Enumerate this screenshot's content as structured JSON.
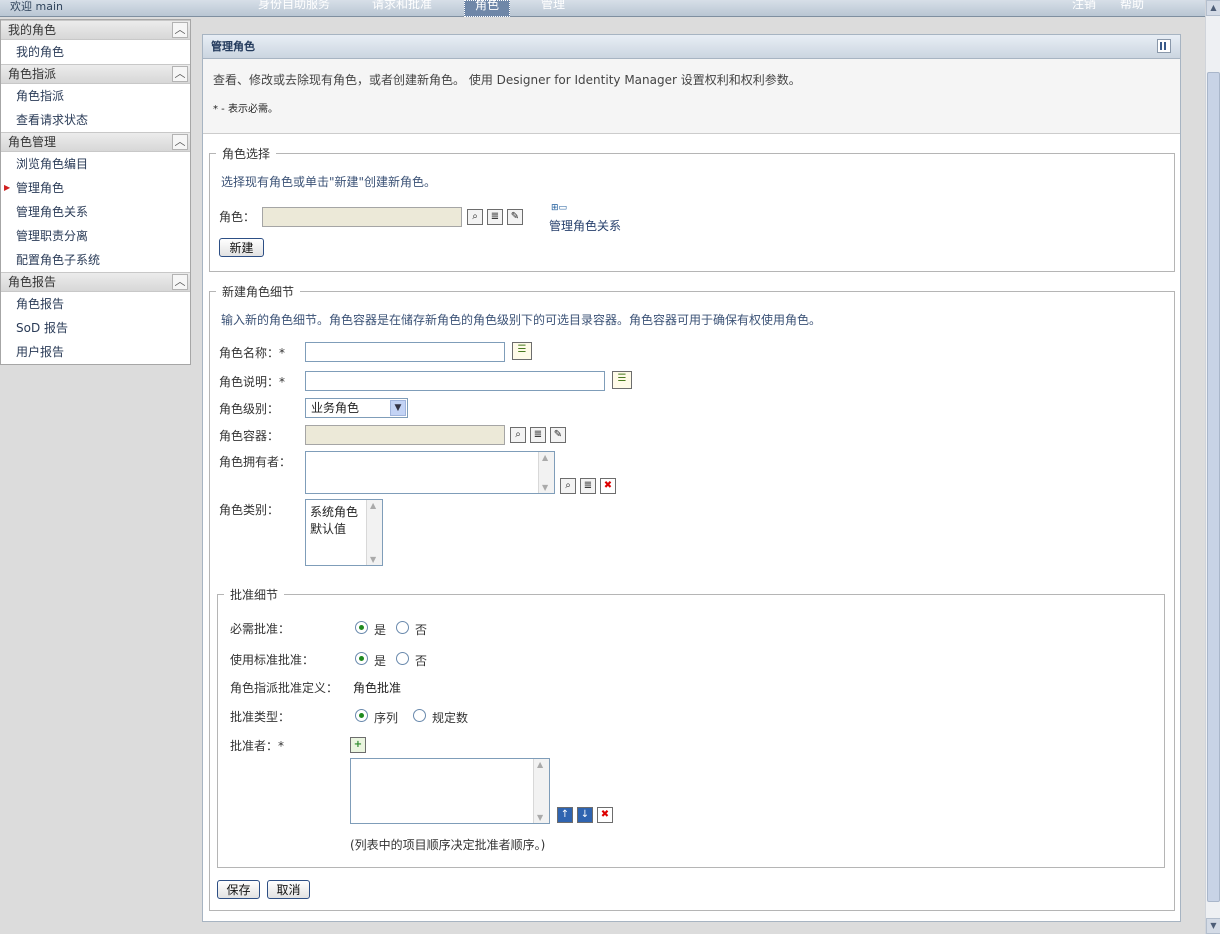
{
  "topbar": {
    "welcome": "欢迎 main",
    "nav": [
      "身份自助服务",
      "请求和批准",
      "角色",
      "管理"
    ],
    "logout": "注销",
    "help": "帮助"
  },
  "sidebar": {
    "sections": [
      {
        "title": "我的角色",
        "items": [
          "我的角色"
        ]
      },
      {
        "title": "角色指派",
        "items": [
          "角色指派",
          "查看请求状态"
        ]
      },
      {
        "title": "角色管理",
        "items": [
          "浏览角色编目",
          "管理角色",
          "管理角色关系",
          "管理职责分离",
          "配置角色子系统"
        ]
      },
      {
        "title": "角色报告",
        "items": [
          "角色报告",
          "SoD 报告",
          "用户报告"
        ]
      }
    ],
    "active_item": "管理角色"
  },
  "panel": {
    "title": "管理角色",
    "intro": "查看、修改或去除现有角色，或者创建新角色。 使用 Designer for Identity Manager 设置权利和权利参数。",
    "required_note": "* - 表示必需。"
  },
  "role_select": {
    "legend": "角色选择",
    "hint": "选择现有角色或单击\"新建\"创建新角色。",
    "role_label": "角色：",
    "role_value": "",
    "manage_link": "管理角色关系",
    "new_button": "新建"
  },
  "new_role": {
    "legend": "新建角色细节",
    "hint": "输入新的角色细节。角色容器是在储存新角色的角色级别下的可选目录容器。角色容器可用于确保有权使用角色。",
    "name_label": "角色名称：*",
    "name_value": "",
    "desc_label": "角色说明：*",
    "desc_value": "",
    "level_label": "角色级别：",
    "level_value": "业务角色",
    "container_label": "角色容器：",
    "container_value": "",
    "owner_label": "角色拥有者：",
    "category_label": "角色类别：",
    "categories": [
      "系统角色",
      "默认值"
    ]
  },
  "approval": {
    "legend": "批准细节",
    "required_label": "必需批准：",
    "required_yes": "是",
    "required_no": "否",
    "standard_label": "使用标准批准：",
    "standard_yes": "是",
    "standard_no": "否",
    "definition_label": "角色指派批准定义：",
    "definition_value": "角色批准",
    "type_label": "批准类型：",
    "type_serial": "序列",
    "type_quorum": "规定数",
    "approvers_label": "批准者：*",
    "order_note": "(列表中的项目顺序决定批准者顺序。)"
  },
  "footer": {
    "save_button": "保存",
    "cancel_button": "取消"
  }
}
